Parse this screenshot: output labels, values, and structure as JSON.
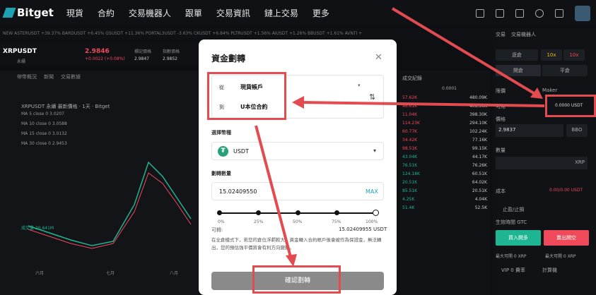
{
  "nav": {
    "brand": "Bitget",
    "items": [
      "現貨",
      "合約",
      "交易機器人",
      "跟單",
      "交易資訊",
      "鏈上交易",
      "更多"
    ]
  },
  "ticker_text": "NEW  ASTERUSDT +39.37%  BARDUSDT +6.45%  GSUSDT +11.36%  PORTAL3USDT -3.63%  CKUSDT +6.84%  PLTRUSDT +1.56%  AIUSDT +1.26%  BBUSDT +1.61%  AVNTI +",
  "pair": {
    "symbol": "XRPUSDT",
    "sub": "永續",
    "price": "2.9846",
    "change": "+0.0022 (+0.08%)",
    "mark_label": "標記價格",
    "mark": "2.9847",
    "index_label": "指數價格",
    "index": "2.9852"
  },
  "chart": {
    "tabs": [
      "帶幣概況",
      "新聞",
      "交易數據"
    ],
    "title": "XRPUSDT 永續 最新價格 · 1天 · Bitget",
    "ma": [
      "MA 5 close 0   3.0207",
      "MA 10 close 0   3.0588",
      "MA 15 close 0   3.0132",
      "MA 30 close 0   2.9453"
    ],
    "x_labels": [
      "六月",
      "七月",
      "八月"
    ],
    "volume": "成交量   20.641M"
  },
  "orderbook": {
    "header": "成交紀錄",
    "tick": "0.0001",
    "rows": [
      [
        "57.62K",
        "480.09K"
      ],
      [
        "46.61K",
        "408.50K"
      ],
      [
        "11.04K",
        "398.30K"
      ],
      [
        "114.23K",
        "294.10K"
      ],
      [
        "60.77K",
        "102.24K"
      ],
      [
        "34.42K",
        "77.16K"
      ],
      [
        "98.51K",
        "99.15K"
      ],
      [
        "43.04K",
        "44.17K"
      ],
      [
        "76.51K",
        "76.26K"
      ],
      [
        "124.18K",
        "60.51K"
      ],
      [
        "20.51K",
        "64.02K"
      ],
      [
        "85.51K",
        "20.51K"
      ],
      [
        "4.25K",
        "4.04K"
      ],
      [
        "51.4K",
        "52.5K"
      ]
    ]
  },
  "right": {
    "tabs": [
      "交易",
      "交易機器人"
    ],
    "mode1": "逐倉",
    "lev1": "10x",
    "lev2": "10x",
    "b1": "開倉",
    "b2": "平倉",
    "market": "限價",
    "maker": "Maker",
    "avail_label": "可用",
    "avail": "0.0000 USDT",
    "price_label": "價格",
    "price": "2.9837",
    "bbo": "BBO",
    "qty_label": "數量",
    "qty_unit": "XRP",
    "cost_label": "成本",
    "cost": "0.00/0.00 USDT",
    "tpsl": "止盈/止損",
    "tif": "生效時間 GTC",
    "buy": "買入開多",
    "sell": "賣出開空",
    "max1": "最大可開 0 XRP",
    "max2": "最大可開 0 XRP",
    "vip": "VIP 0 費率",
    "calc": "計算機"
  },
  "modal": {
    "title": "資金劃轉",
    "from_label": "從",
    "from_value": "現貨帳戶",
    "to_label": "到",
    "to_value": "U本位合約",
    "coin_label": "選擇幣種",
    "coin": "USDT",
    "amount_label": "劃轉數量",
    "amount": "15.02409550",
    "max": "MAX",
    "ticks": [
      "0%",
      "25%",
      "50%",
      "75%",
      "100%"
    ],
    "avail_label": "可轉:",
    "avail_value": "15.02409955 USDT",
    "note": "在全倉模式下，若您的倉位浮虧較大，資金轉入合約帳戶後會被作為保證金，無法轉出，您的預估強平價將會有利方向變動。",
    "confirm": "確認劃轉"
  },
  "colors": {
    "accent": "#1da2b4",
    "annotation": "#e24b4f",
    "up": "#1fb592",
    "down": "#f04a5a"
  }
}
